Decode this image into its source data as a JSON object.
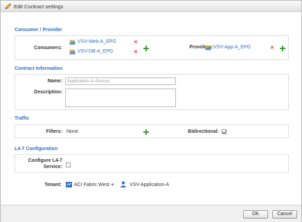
{
  "dialog": {
    "title": "Edit Contract settings"
  },
  "consumer_provider": {
    "title": "Consumer / Provider",
    "consumers_label": "Consumers:",
    "consumers": [
      "VSV-Web-A_EPG",
      "VSV-DB-A_EPG"
    ],
    "providers_label": "Providers:",
    "providers": [
      "VSV-App-A_EPG"
    ]
  },
  "contract_info": {
    "title": "Contract Information",
    "name_label": "Name:",
    "name_value": "Application-A-Access",
    "description_label": "Description:"
  },
  "traffic": {
    "title": "Traffic",
    "filters_label": "Filters:",
    "filters_value": "None",
    "bidirectional_label": "Bidirectional:",
    "bidirectional_checked": true
  },
  "l47": {
    "title": "L4-7 Configuration",
    "configure_label_line1": "Configure L4-7",
    "configure_label_line2": "Service:",
    "configure_checked": false
  },
  "tenant": {
    "label": "Tenant:",
    "fabric": "ACI Fabric West",
    "application": "VSV-Application-A"
  },
  "footer": {
    "ok_label": "OK",
    "cancel_label": "Cancel"
  }
}
